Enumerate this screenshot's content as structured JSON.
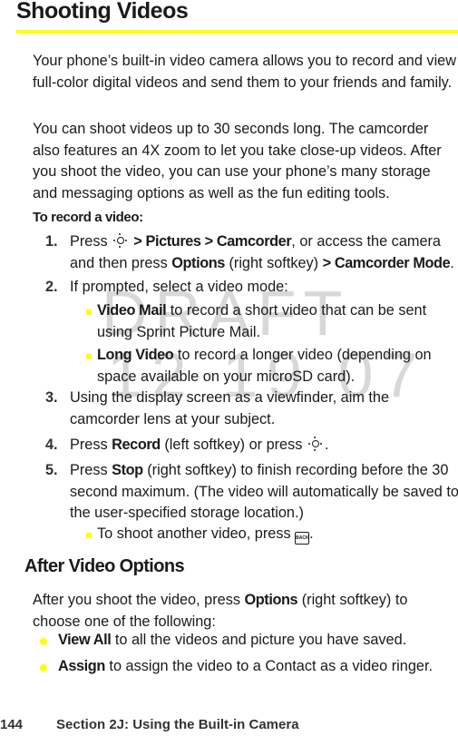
{
  "title": "Shooting Videos",
  "colors": {
    "accent": "#ffff00",
    "watermark": "#d8d8d8"
  },
  "watermark": {
    "line1": "DRAFT",
    "line2": "12 19 07"
  },
  "intro": [
    "Your phone’s built-in video camera allows you to record and view full-color digital videos and send them to your friends and family.",
    "You can shoot videos up to 30 seconds long. The camcorder also features an 4X zoom to let you take close-up videos. After you shoot the video, you can use your phone’s many storage and messaging options as well as the fun editing tools."
  ],
  "procedure": {
    "heading": "To record a video:",
    "steps": [
      {
        "num": "1.",
        "pre": "Press",
        "icon": "navigation-key-icon",
        "b1": " > Pictures > Camcorder",
        "mid": ", or access the camera and then press ",
        "b2": "Options",
        "mid2": " (right softkey) ",
        "b3": "> Camcorder Mode",
        "post": "."
      },
      {
        "num": "2.",
        "text": "If prompted, select a video mode:",
        "subitems": [
          {
            "bold": "Video Mail",
            "text": " to record a short video that can be sent using Sprint Picture Mail."
          },
          {
            "bold": "Long Video",
            "text": " to record a longer video (depending on space available on your microSD card)."
          }
        ]
      },
      {
        "num": "3.",
        "text": "Using the display screen as a viewfinder, aim the camcorder lens at your subject."
      },
      {
        "num": "4.",
        "pre": "Press ",
        "bold": "Record",
        "mid": " (left softkey) or press ",
        "icon": "navigation-key-icon",
        "post": "."
      },
      {
        "num": "5.",
        "pre": "Press ",
        "bold": "Stop",
        "text": " (right softkey) to finish recording before the 30 second maximum. (The video will automatically be saved to the user-specified storage location.)",
        "subitems": [
          {
            "text": "To shoot another video, press ",
            "icon": "back-key-icon",
            "icon_label": "BACK",
            "post": "."
          }
        ]
      }
    ]
  },
  "after": {
    "heading": "After Video Options",
    "pre": "After you shoot the video, press ",
    "bold": "Options",
    "post": " (right softkey) to choose one of the following:",
    "items": [
      {
        "bold": "View All",
        "text": " to all the videos and picture you have saved."
      },
      {
        "bold": "Assign",
        "text": " to assign the video to a Contact as a video ringer."
      }
    ]
  },
  "footer": {
    "page": "144",
    "section": "Section 2J: Using the Built-in Camera"
  }
}
